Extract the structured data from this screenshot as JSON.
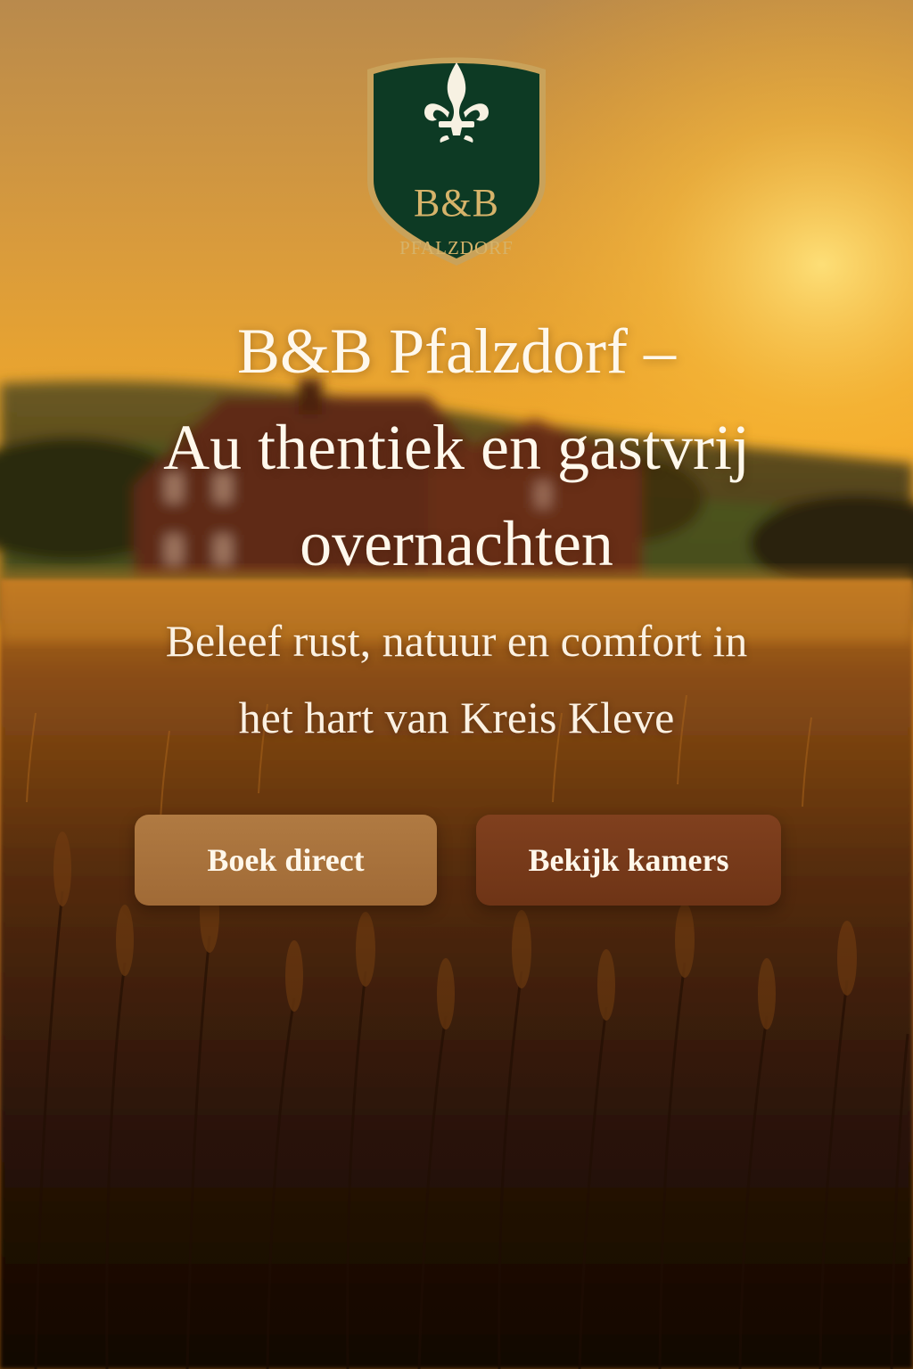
{
  "logo": {
    "icon": "fleur-de-lis-icon",
    "line1": "B&B",
    "line2": "PFALZDORF"
  },
  "hero": {
    "title_lines": [
      "B&B Pfalzdorf –",
      "Au thentiek en gastvrij",
      "overnachten"
    ],
    "subtitle_lines": [
      "Beleef rust, natuur en comfort in",
      "het hart van Kreis Kleve"
    ]
  },
  "actions": {
    "book_label": "Boek direct",
    "rooms_label": "Bekijk kamers"
  },
  "colors": {
    "shield_green": "#0d3a24",
    "gold": "#d6b36a",
    "button_book": "#a8723c",
    "button_rooms": "#763a1a",
    "text_light": "#fff8ec"
  }
}
